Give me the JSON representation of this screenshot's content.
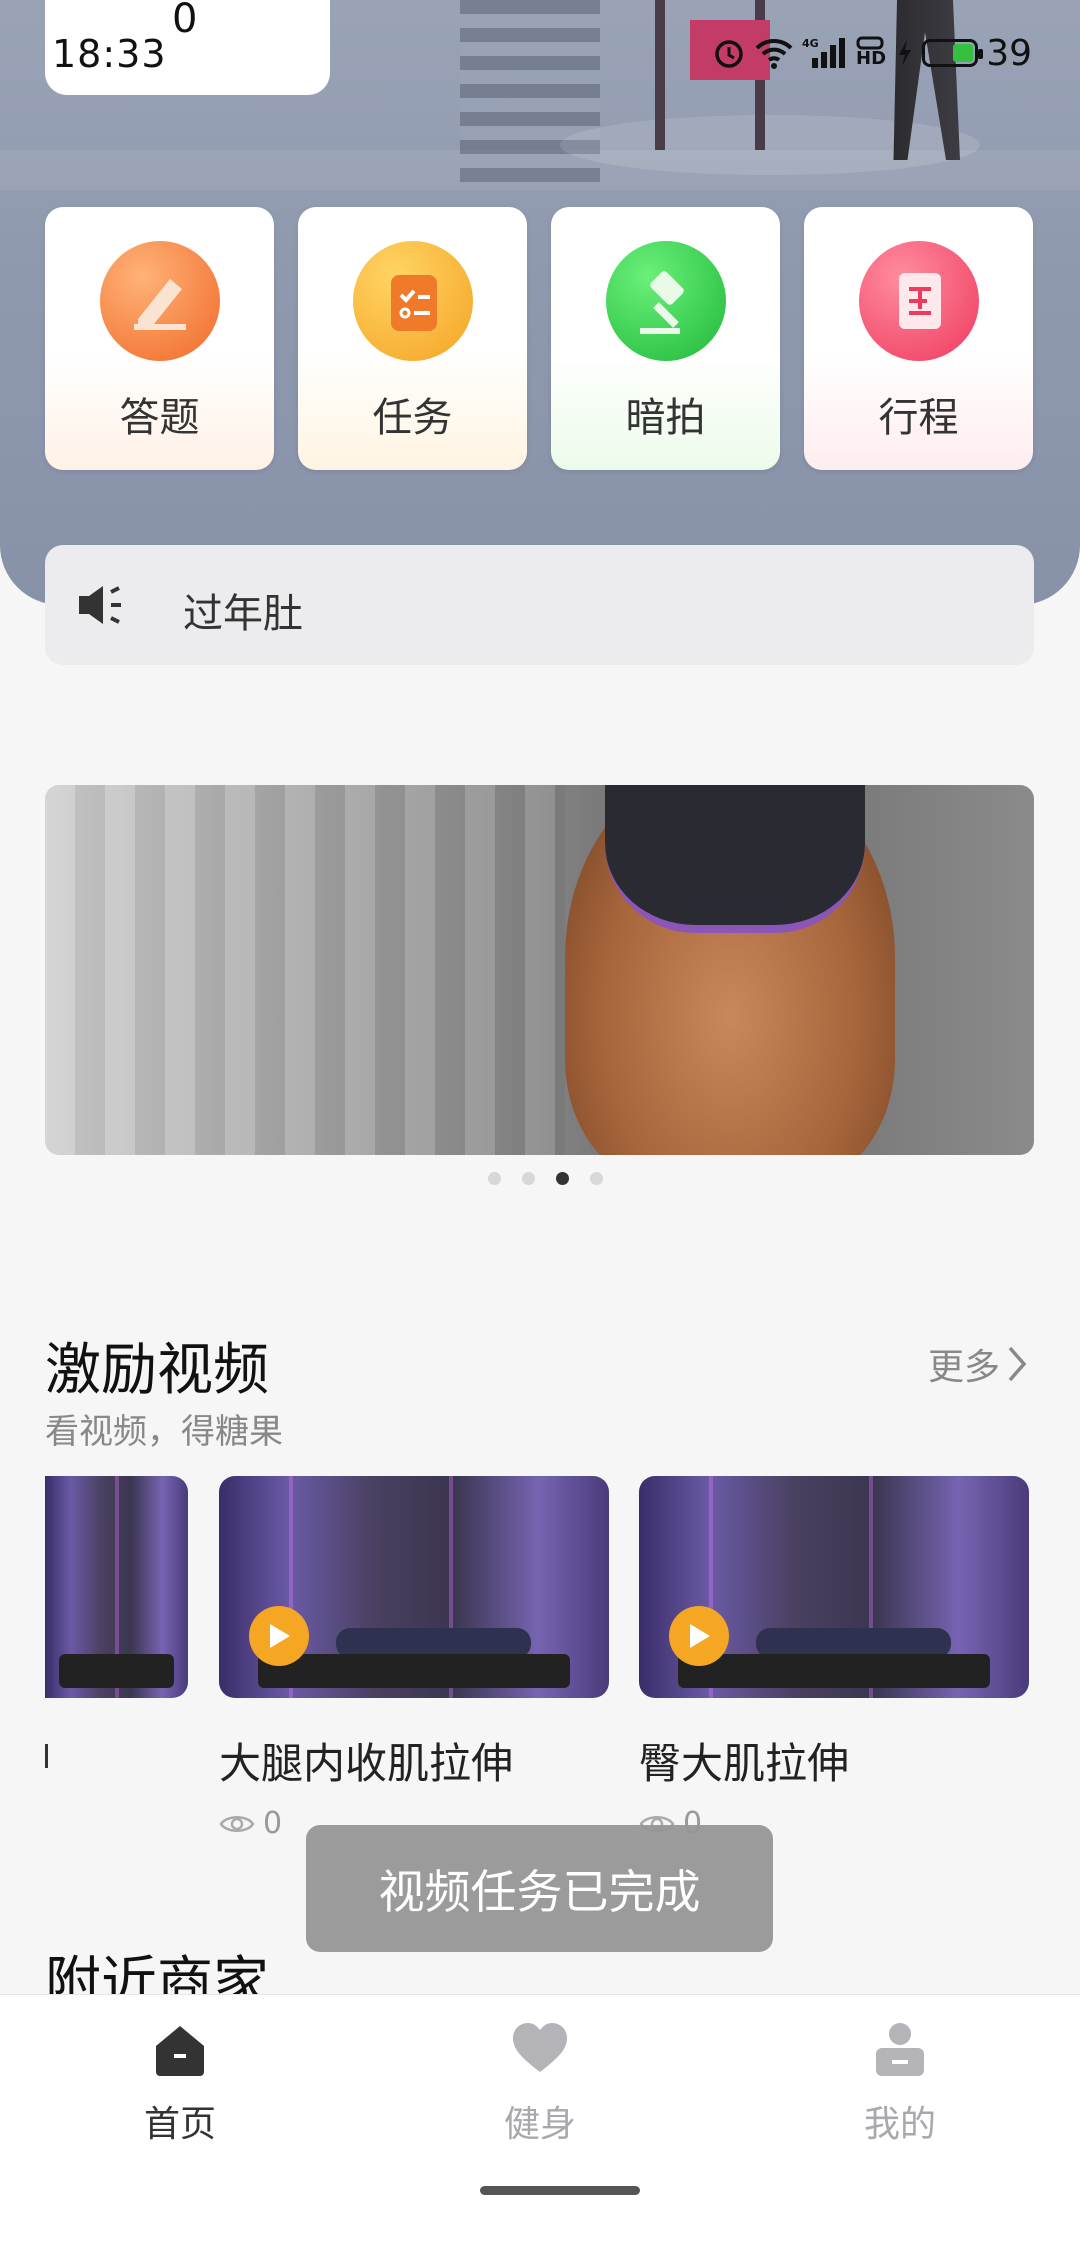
{
  "status_bar": {
    "time": "18:33",
    "notification_count": "0",
    "battery": "39"
  },
  "quick_actions": [
    {
      "label": "答题",
      "icon": "pencil-icon",
      "color": "#f47a3b"
    },
    {
      "label": "任务",
      "icon": "task-list-icon",
      "color": "#f4a224"
    },
    {
      "label": "暗拍",
      "icon": "auction-hammer-icon",
      "color": "#2cc94b"
    },
    {
      "label": "行程",
      "icon": "itinerary-document-icon",
      "color": "#f04f6e"
    }
  ],
  "notice": {
    "text": "过年肚"
  },
  "banner": {
    "total_slides": 4,
    "active_slide": 3
  },
  "incentive_section": {
    "title": "激励视频",
    "subtitle": "看视频，得糖果",
    "more_label": "更多",
    "videos": [
      {
        "title": "大腿内收肌拉伸",
        "views": "0"
      },
      {
        "title": "臀大肌拉伸",
        "views": "0"
      }
    ]
  },
  "toast": {
    "text": "视频任务已完成"
  },
  "nearby_section": {
    "title": "附近商家"
  },
  "bottom_nav": [
    {
      "label": "首页",
      "icon": "home-icon",
      "active": true
    },
    {
      "label": "健身",
      "icon": "heart-icon",
      "active": false
    },
    {
      "label": "我的",
      "icon": "profile-icon",
      "active": false
    }
  ],
  "colors": {
    "accent_play": "#f5a623",
    "nav_active": "#333333",
    "nav_inactive": "#a8a8ad"
  }
}
